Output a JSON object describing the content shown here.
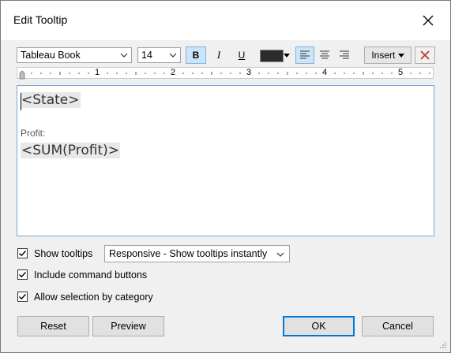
{
  "dialog": {
    "title": "Edit Tooltip"
  },
  "toolbar": {
    "font_family": "Tableau Book",
    "font_size": "14",
    "bold_label": "B",
    "italic_label": "I",
    "underline_label": "U",
    "text_color": "#2b2b2b",
    "insert_label": "Insert"
  },
  "ruler": {
    "marks": [
      "1",
      "2",
      "3",
      "4",
      "5"
    ]
  },
  "editor": {
    "line1_field": "<State>",
    "line2_label": "Profit:",
    "line3_field": "<SUM(Profit)>"
  },
  "options": {
    "show_tooltips_label": "Show tooltips",
    "show_tooltips_checked": true,
    "tooltip_mode_value": "Responsive - Show tooltips instantly",
    "command_buttons_label": "Include command buttons",
    "command_buttons_checked": true,
    "selection_label": "Allow selection by category",
    "selection_checked": true
  },
  "buttons": {
    "reset": "Reset",
    "preview": "Preview",
    "ok": "OK",
    "cancel": "Cancel"
  },
  "colors": {
    "accent": "#0078d7",
    "toggle_on_bg": "#cce4f7",
    "clear_x": "#c0392b"
  }
}
